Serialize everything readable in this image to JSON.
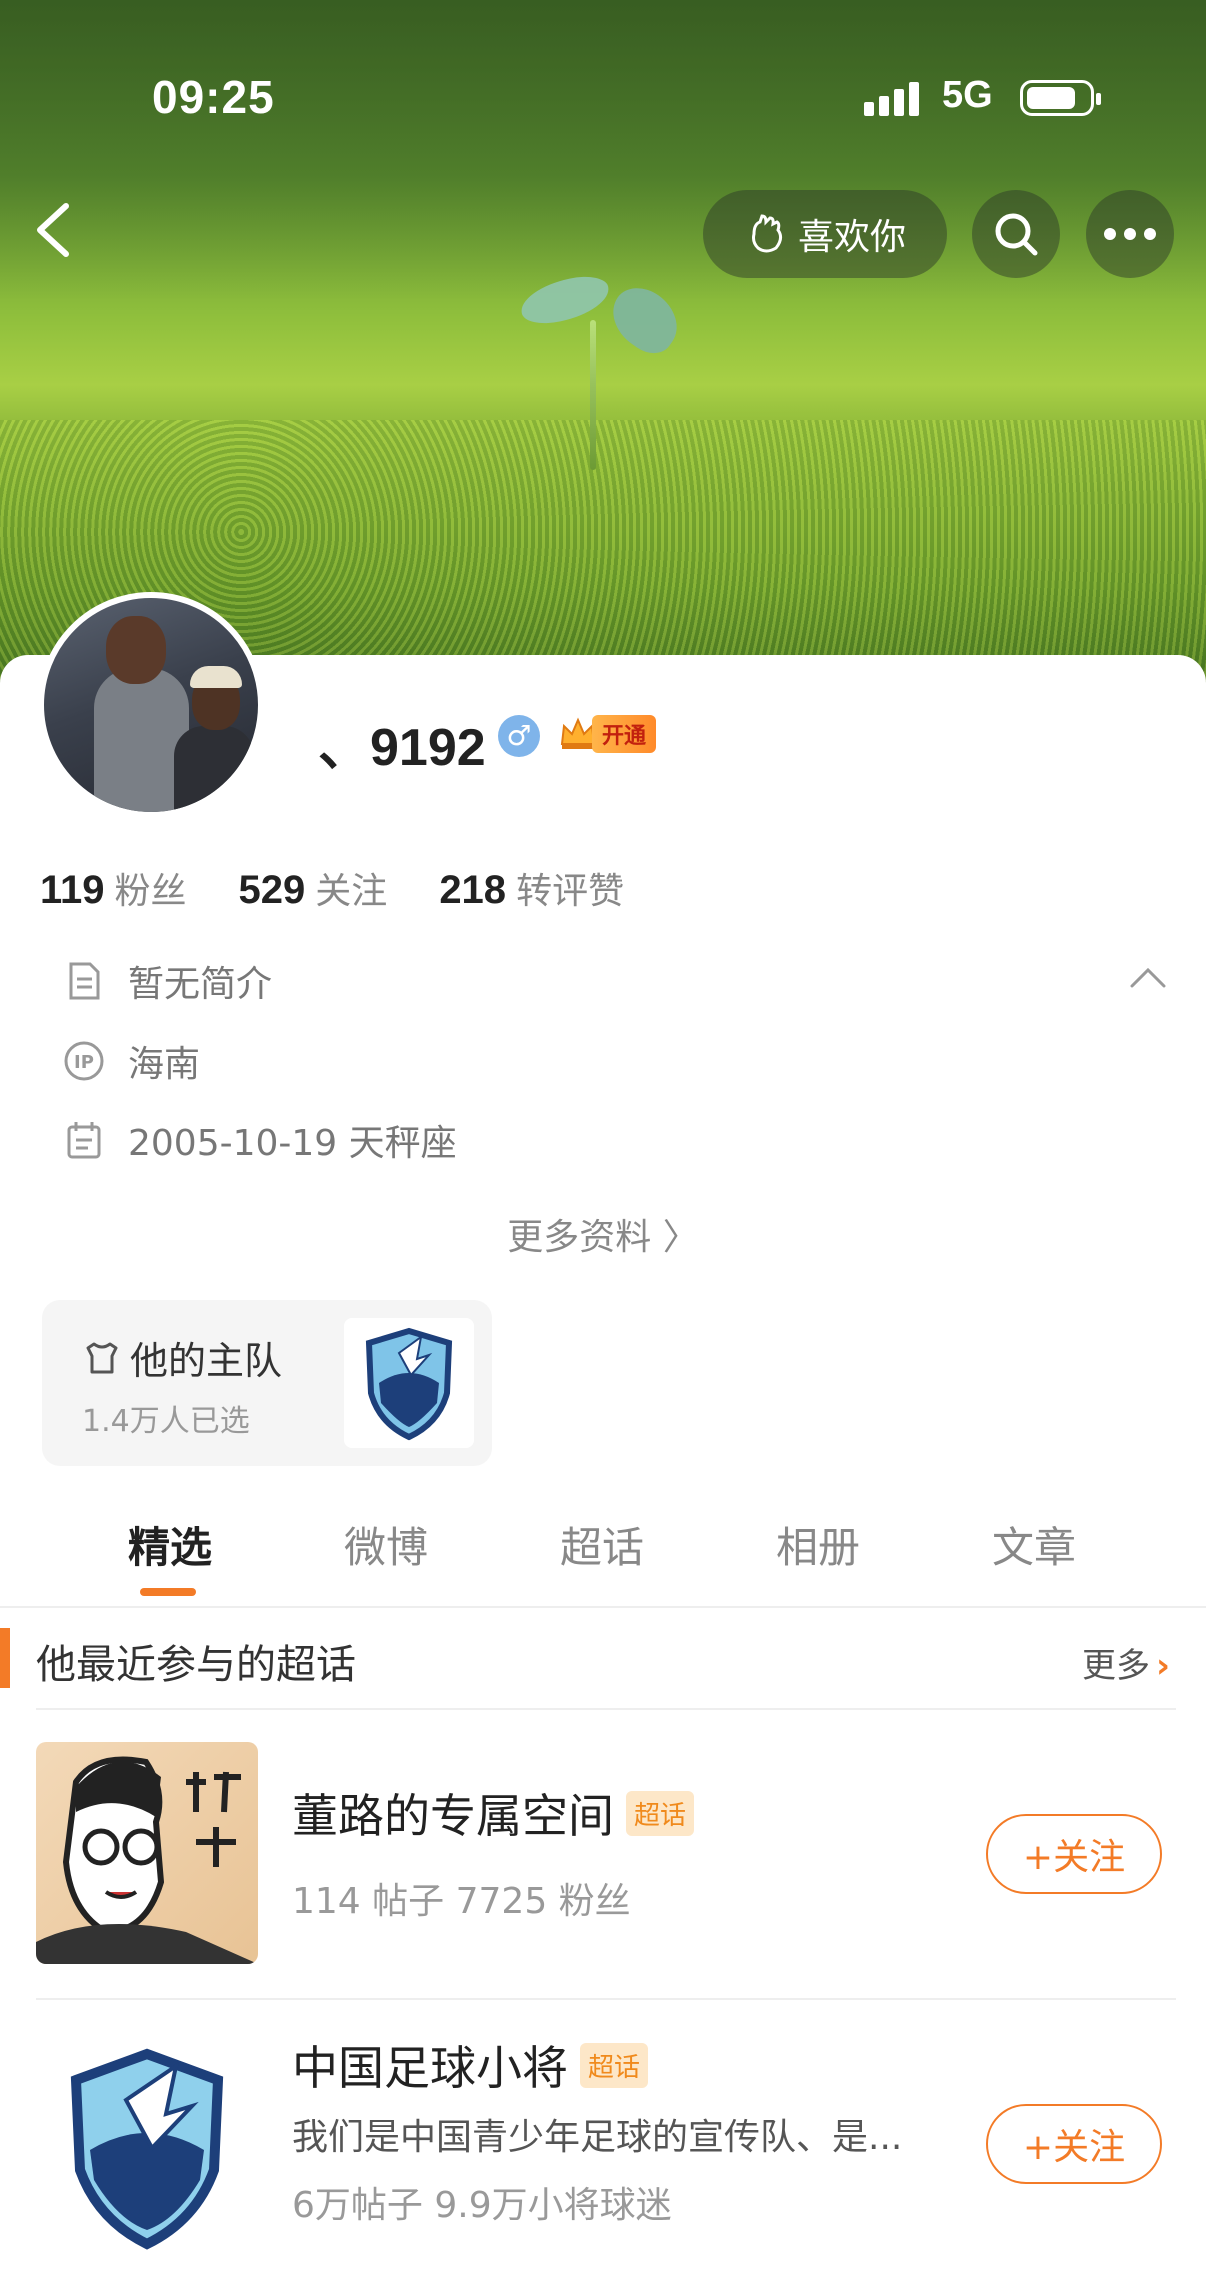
{
  "status_bar": {
    "time": "09:25",
    "network": "5G"
  },
  "header": {
    "like_label": "喜欢你"
  },
  "profile": {
    "username": "、9192",
    "gender_symbol": "♂",
    "vip_label": "开通",
    "stats": [
      {
        "value": "119",
        "label": "粉丝"
      },
      {
        "value": "529",
        "label": "关注"
      },
      {
        "value": "218",
        "label": "转评赞"
      }
    ],
    "bio": "暂无简介",
    "ip_location": "海南",
    "birthday": "2005-10-19 天秤座",
    "more_info": "更多资料 〉"
  },
  "team": {
    "title": "他的主队",
    "subtitle": "1.4万人已选"
  },
  "tabs": [
    "精选",
    "微博",
    "超话",
    "相册",
    "文章"
  ],
  "section": {
    "title": "他最近参与的超话",
    "more_label": "更多",
    "more_arrow": "›"
  },
  "topics": [
    {
      "title": "董路的专属空间",
      "tag": "超话",
      "meta": "114 帖子 7725 粉丝",
      "follow_label": "+关注"
    },
    {
      "title": "中国足球小将",
      "tag": "超话",
      "description": "我们是中国青少年足球的宣传队、是...",
      "meta": "6万帖子 9.9万小将球迷",
      "follow_label": "+关注"
    }
  ],
  "colors": {
    "accent": "#f37b27",
    "tag_bg": "#fde7c8",
    "gender_blue": "#7fb4ea"
  }
}
